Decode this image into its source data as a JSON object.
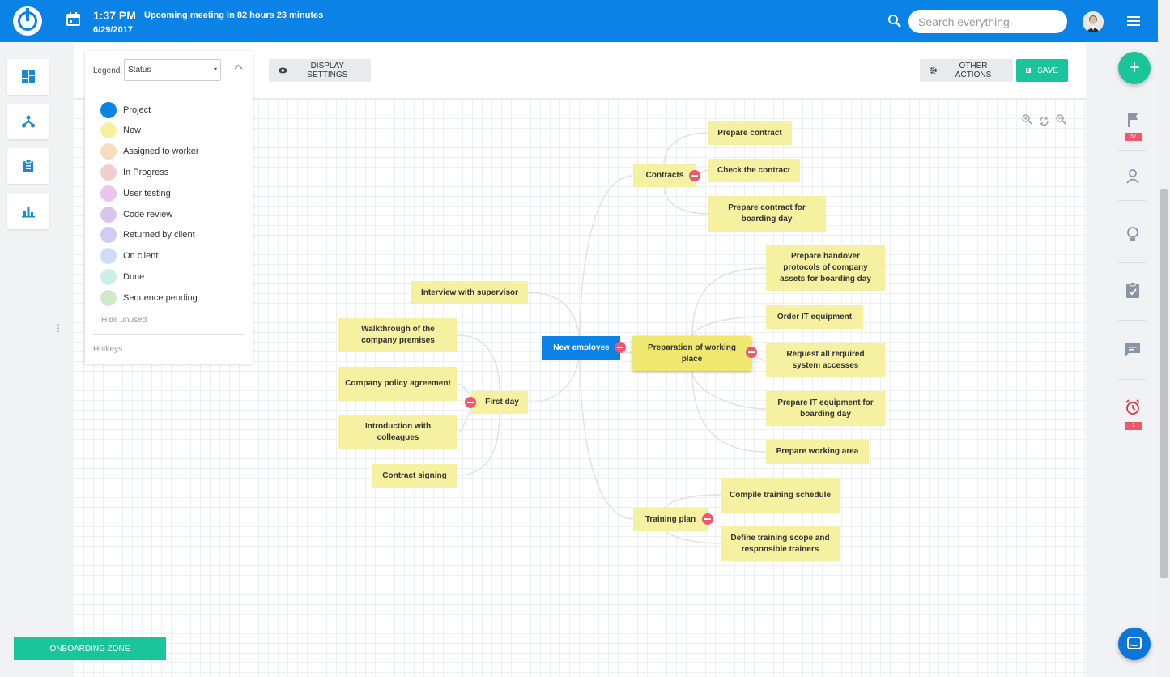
{
  "topbar": {
    "time": "1:37 PM",
    "meeting": "Upcoming meeting in 82 hours 23 minutes",
    "date": "6/29/2017",
    "search_placeholder": "Search everything",
    "brand_color": "#0a82e6"
  },
  "toolbar": {
    "display_settings": "DISPLAY SETTINGS",
    "other_actions": "OTHER ACTIONS",
    "save": "SAVE"
  },
  "legend": {
    "label": "Legend:",
    "selected": "Status",
    "items": [
      {
        "label": "Project",
        "color": "#0a82e6"
      },
      {
        "label": "New",
        "color": "#f6f1a0"
      },
      {
        "label": "Assigned to worker",
        "color": "#f8dcbe"
      },
      {
        "label": "In Progress",
        "color": "#f3cdd0"
      },
      {
        "label": "User testing",
        "color": "#ebc5ec"
      },
      {
        "label": "Code review",
        "color": "#d8c5ee"
      },
      {
        "label": "Returned by client",
        "color": "#cfcdf5"
      },
      {
        "label": "On client",
        "color": "#cfdcf7"
      },
      {
        "label": "Done",
        "color": "#cdeee9"
      },
      {
        "label": "Sequence pending",
        "color": "#cfe9c9"
      }
    ],
    "hide_unused": "Hide unused",
    "hotkeys": "Hotkeys"
  },
  "mindmap": {
    "root": "New employee",
    "nodes": {
      "contracts": "Contracts",
      "prepare_contract": "Prepare contract",
      "check_contract": "Check the contract",
      "prepare_contract_boarding": "Prepare contract for boarding day",
      "preparation": "Preparation of working place",
      "handover": "Prepare handover protocols of company assets for boarding day",
      "order_it": "Order IT equipment",
      "request_access": "Request all required system accesses",
      "prepare_it": "Prepare IT equipment for boarding day",
      "working_area": "Prepare working area",
      "training_plan": "Training plan",
      "compile_training": "Compile training schedule",
      "define_training": "Define training scope and responsible trainers",
      "interview": "Interview with supervisor",
      "first_day": "First day",
      "walkthrough": "Walkthrough of the company premises",
      "policy": "Company policy agreement",
      "introduction": "Introduction with colleagues",
      "contract_signing": "Contract signing"
    }
  },
  "rightbar": {
    "flag_badge": "57",
    "alarm_badge": "1"
  },
  "onboarding": "ONBOARDING ZONE"
}
